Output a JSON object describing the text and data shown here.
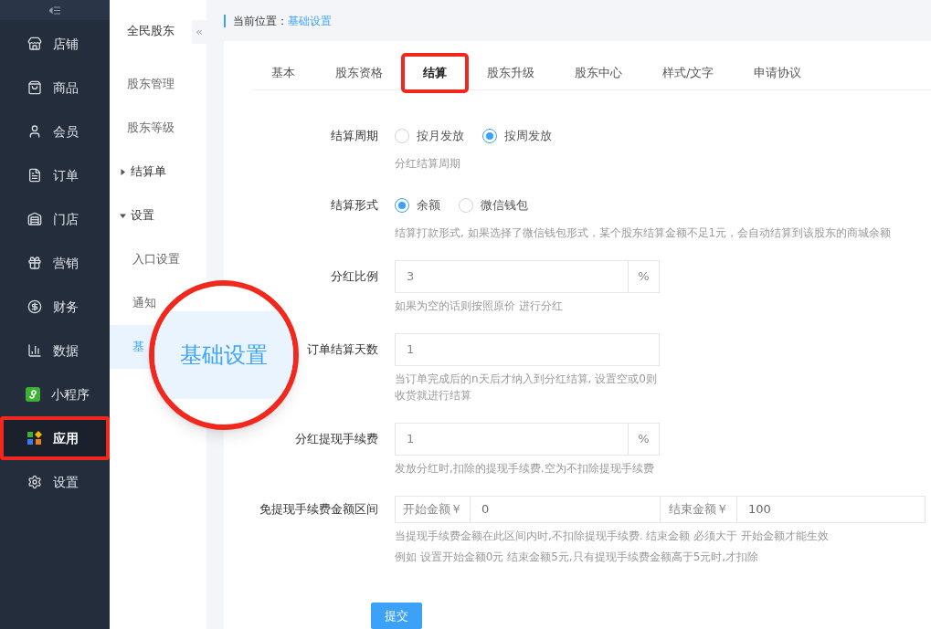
{
  "sidebar": {
    "items": [
      {
        "label": "店铺",
        "selected": false,
        "highlighted": false
      },
      {
        "label": "商品",
        "selected": false,
        "highlighted": false
      },
      {
        "label": "会员",
        "selected": false,
        "highlighted": false
      },
      {
        "label": "订单",
        "selected": false,
        "highlighted": false
      },
      {
        "label": "门店",
        "selected": false,
        "highlighted": false
      },
      {
        "label": "营销",
        "selected": false,
        "highlighted": false
      },
      {
        "label": "财务",
        "selected": false,
        "highlighted": false
      },
      {
        "label": "数据",
        "selected": false,
        "highlighted": false
      },
      {
        "label": "小程序",
        "selected": false,
        "highlighted": false
      },
      {
        "label": "应用",
        "selected": true,
        "highlighted": true
      },
      {
        "label": "设置",
        "selected": false,
        "highlighted": false
      }
    ]
  },
  "submenu": {
    "title": "全民股东",
    "collapse": "«",
    "items": [
      {
        "kind": "link",
        "label": "股东管理"
      },
      {
        "kind": "link",
        "label": "股东等级"
      },
      {
        "kind": "group",
        "label": "结算单",
        "expanded": false
      },
      {
        "kind": "group",
        "label": "设置",
        "expanded": true,
        "children": [
          {
            "label": "入口设置",
            "selected": false
          },
          {
            "label": "通知",
            "selected": false
          },
          {
            "label": "基",
            "selected": true
          }
        ]
      }
    ]
  },
  "magnifier": {
    "text": "基础设置"
  },
  "breadcrumb": {
    "label": "当前位置：",
    "current": "基础设置"
  },
  "tabs": [
    {
      "label": "基本",
      "selected": false,
      "highlighted": false
    },
    {
      "label": "股东资格",
      "selected": false,
      "highlighted": false
    },
    {
      "label": "结算",
      "selected": true,
      "highlighted": true
    },
    {
      "label": "股东升级",
      "selected": false,
      "highlighted": false
    },
    {
      "label": "股东中心",
      "selected": false,
      "highlighted": false
    },
    {
      "label": "样式/文字",
      "selected": false,
      "highlighted": false
    },
    {
      "label": "申请协议",
      "selected": false,
      "highlighted": false
    }
  ],
  "form": {
    "fields": [
      {
        "kind": "radio",
        "label": "结算周期",
        "options": [
          {
            "label": "按月发放",
            "selected": false
          },
          {
            "label": "按周发放",
            "selected": true
          }
        ],
        "hints": [
          "分红结算周期"
        ]
      },
      {
        "kind": "radio",
        "label": "结算形式",
        "options": [
          {
            "label": "余额",
            "selected": true
          },
          {
            "label": "微信钱包",
            "selected": false
          }
        ],
        "hints": [
          "结算打款形式, 如果选择了微信钱包形式，某个股东结算金额不足1元，会自动结算到该股东的商城余额"
        ]
      },
      {
        "kind": "input",
        "label": "分红比例",
        "value": "3",
        "suffix": "%",
        "hints": [
          "如果为空的话则按照原价 进行分红"
        ]
      },
      {
        "kind": "input",
        "label": "订单结算天数",
        "value": "1",
        "hints": [
          "当订单完成后的n天后才纳入到分红结算, 设置空或0则收货就进行结算"
        ]
      },
      {
        "kind": "input",
        "label": "分红提现手续费",
        "value": "1",
        "suffix": "%",
        "hints": [
          "发放分红时,扣除的提现手续费.空为不扣除提现手续费"
        ]
      },
      {
        "kind": "range",
        "label": "免提现手续费金额区间",
        "start_prefix": "开始金额￥",
        "start_value": "0",
        "end_prefix": "结束金额￥",
        "end_value": "100",
        "hints": [
          "当提现手续费金额在此区间内时,不扣除提现手续费. 结束金额 必须大于 开始金额才能生效",
          "例如 设置开始金额0元 结束金额5元,只有提现手续费金额高于5元时,才扣除"
        ]
      }
    ]
  },
  "submit": "提交"
}
